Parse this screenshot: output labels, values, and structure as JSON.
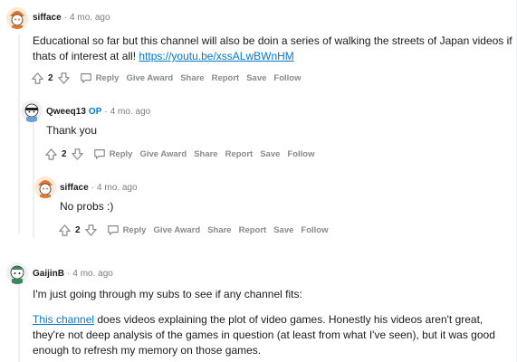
{
  "comments": [
    {
      "user": "sifface",
      "op": "",
      "time": "4 mo. ago",
      "text": "Educational so far but this channel will also be doin a series of walking the streets of Japan videos if thats of interest at all! ",
      "link": "https://youtu.be/xssALwBWnHM",
      "score": "2",
      "actions": [
        "Reply",
        "Give Award",
        "Share",
        "Report",
        "Save",
        "Follow"
      ]
    },
    {
      "user": "Qweeq13",
      "op": "OP",
      "time": "4 mo. ago",
      "text": "Thank you",
      "score": "2",
      "actions": [
        "Reply",
        "Give Award",
        "Share",
        "Report",
        "Save",
        "Follow"
      ]
    },
    {
      "user": "sifface",
      "op": "",
      "time": "4 mo. ago",
      "text": "No probs :)",
      "score": "2",
      "actions": [
        "Reply",
        "Give Award",
        "Share",
        "Report",
        "Save",
        "Follow"
      ]
    },
    {
      "user": "GaijinB",
      "op": "",
      "time": "4 mo. ago",
      "text": "I'm just going through my subs to see if any channel fits:",
      "link": "This channel",
      "text2": " does videos explaining the plot of video games. Honestly his videos aren't great, they're not deep analysis of the games in question (at least from what I've seen), but it was good enough to refresh my memory on those games."
    }
  ],
  "icons": {
    "upvote": "upvote-arrow-icon",
    "downvote": "downvote-arrow-icon",
    "reply": "speech-bubble-icon",
    "avatar": "snoo-avatar-icon"
  },
  "colors": {
    "link": "#0079d3",
    "muted": "#7c7c7c",
    "action": "#878a8c",
    "thread": "#edeff1"
  }
}
